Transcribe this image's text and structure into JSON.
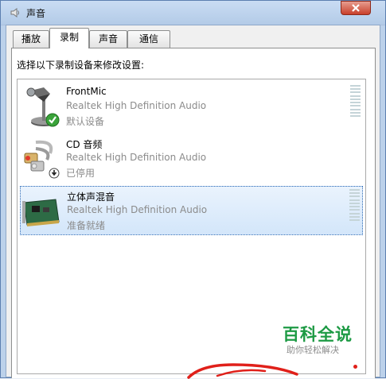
{
  "window": {
    "title": "声音"
  },
  "tabs": [
    {
      "label": "播放",
      "selected": false
    },
    {
      "label": "录制",
      "selected": true
    },
    {
      "label": "声音",
      "selected": false
    },
    {
      "label": "通信",
      "selected": false
    }
  ],
  "instruction": "选择以下录制设备来修改设置:",
  "devices": [
    {
      "name": "FrontMic",
      "driver": "Realtek High Definition Audio",
      "status": "默认设备",
      "icon": "microphone-icon",
      "badge": "check-badge-icon"
    },
    {
      "name": "CD 音频",
      "driver": "Realtek High Definition Audio",
      "status": "已停用",
      "icon": "audio-cable-icon",
      "badge": "disabled-badge-icon"
    },
    {
      "name": "立体声混音",
      "driver": "Realtek High Definition Audio",
      "status": "准备就绪",
      "icon": "sound-card-icon",
      "selected": true
    }
  ],
  "watermark": {
    "title": "百科全说",
    "subtitle": "助你轻松解决"
  },
  "colors": {
    "accent": "#2f6bb5",
    "check": "#3aa33a",
    "watermark": "#1d9a44",
    "close": "#c8402b"
  }
}
